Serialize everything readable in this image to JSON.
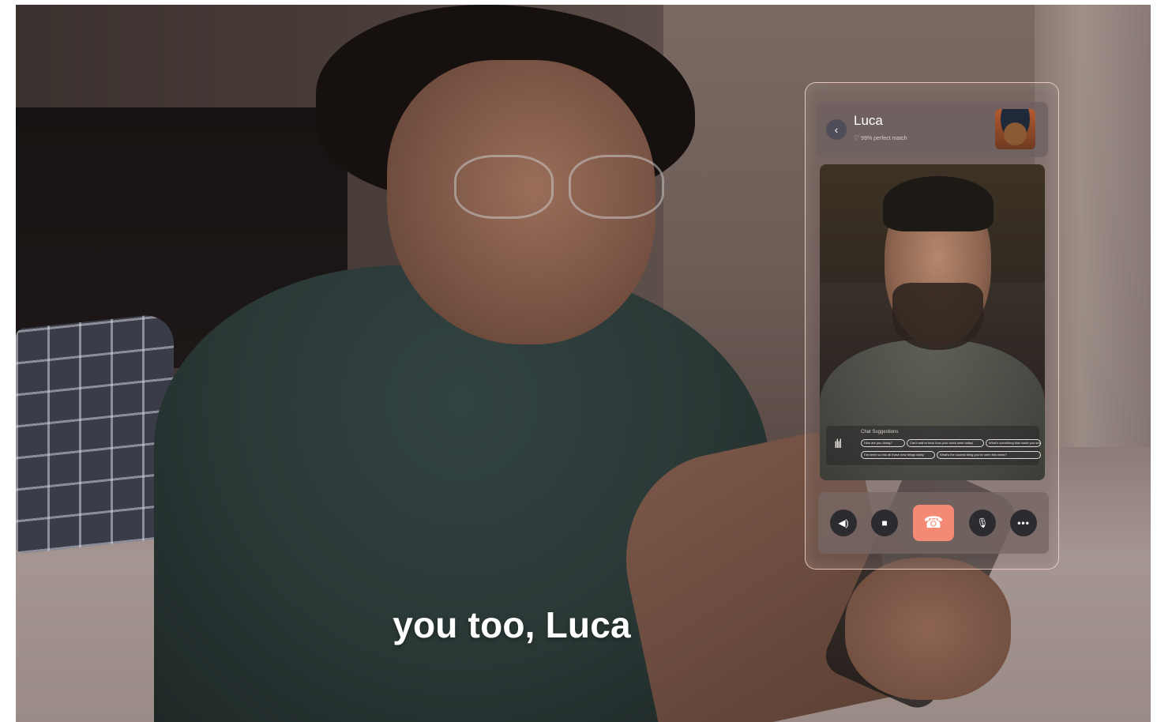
{
  "caption": "you too, Luca",
  "call": {
    "contact_name": "Luca",
    "match_text": "99% perfect match",
    "chat_suggestions": {
      "title": "Chat Suggestions",
      "chips": [
        "How are you doing?",
        "Can't wait to hear how your week went today!",
        "What's something that made you smile?",
        "I've been so into all these new things lately",
        "What's the coolest thing you've seen this week?"
      ]
    },
    "controls": [
      "speaker-icon",
      "camera-icon",
      "end-call-icon",
      "mic-icon",
      "more-icon"
    ],
    "accent_color": "#f48a74"
  }
}
